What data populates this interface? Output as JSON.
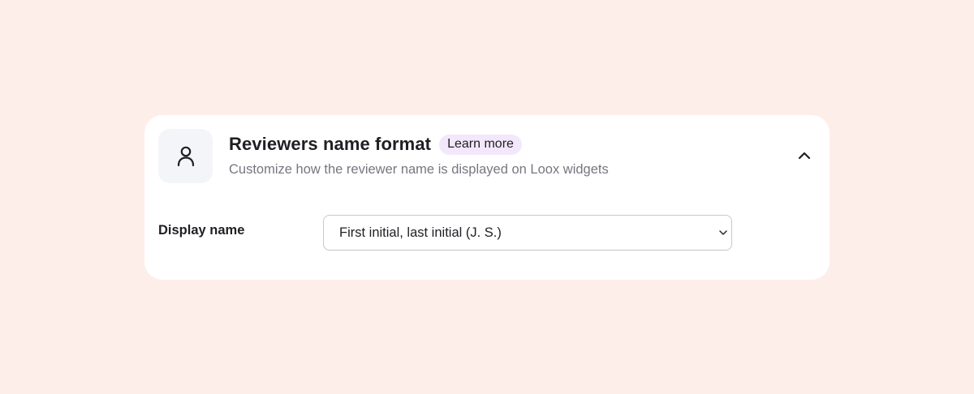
{
  "section": {
    "title": "Reviewers name format",
    "learn_more_label": "Learn more",
    "subtitle": "Customize how the reviewer name is displayed on Loox widgets",
    "icon": "user-icon",
    "collapse_icon": "chevron-up-icon",
    "expanded": true
  },
  "display_name": {
    "label": "Display name",
    "selected_value": "First initial, last initial (J. S.)",
    "dropdown_icon": "chevron-down-icon"
  },
  "colors": {
    "page_background": "#feeeea",
    "card_background": "#ffffff",
    "icon_tile_background": "#f4f5f9",
    "learn_more_background": "#f3e8fb",
    "text_primary": "#1f1f24",
    "text_secondary": "#767680"
  }
}
